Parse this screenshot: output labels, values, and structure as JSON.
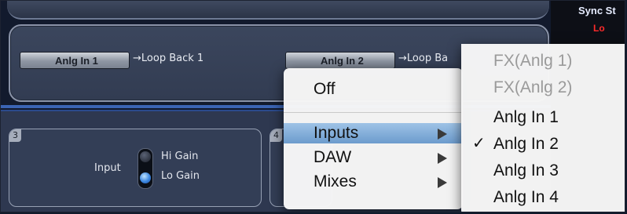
{
  "loop_panel": {
    "row": [
      {
        "source": "Anlg In 1",
        "destination": "→Loop Back 1"
      },
      {
        "source": "Anlg In 2",
        "destination": "→Loop Ba"
      }
    ]
  },
  "channels": [
    {
      "number": "3",
      "input_label": "Input",
      "hi_gain": "Hi Gain",
      "lo_gain": "Lo Gain"
    },
    {
      "number": "4"
    }
  ],
  "sync_panel": {
    "title": "Sync St",
    "indicator": "Lo"
  },
  "context_menu": {
    "items": [
      {
        "label": "Off",
        "has_submenu": false
      },
      {
        "label": "Inputs",
        "has_submenu": true,
        "highlighted": true
      },
      {
        "label": "DAW",
        "has_submenu": true
      },
      {
        "label": "Mixes",
        "has_submenu": true
      }
    ]
  },
  "inputs_submenu": {
    "items": [
      {
        "label": "FX(Anlg 1)",
        "enabled": false,
        "checked": false
      },
      {
        "label": "FX(Anlg 2)",
        "enabled": false,
        "checked": false
      },
      {
        "label": "Anlg In 1",
        "enabled": true,
        "checked": false
      },
      {
        "label": "Anlg In 2",
        "enabled": true,
        "checked": true
      },
      {
        "label": "Anlg In 3",
        "enabled": true,
        "checked": false
      },
      {
        "label": "Anlg In 4",
        "enabled": true,
        "checked": false
      }
    ],
    "check_glyph": "✓"
  },
  "colors": {
    "menu_highlight": "#7ea9d8",
    "gain_led_on": "#3b86df",
    "accent_blue": "#3b64b4"
  }
}
